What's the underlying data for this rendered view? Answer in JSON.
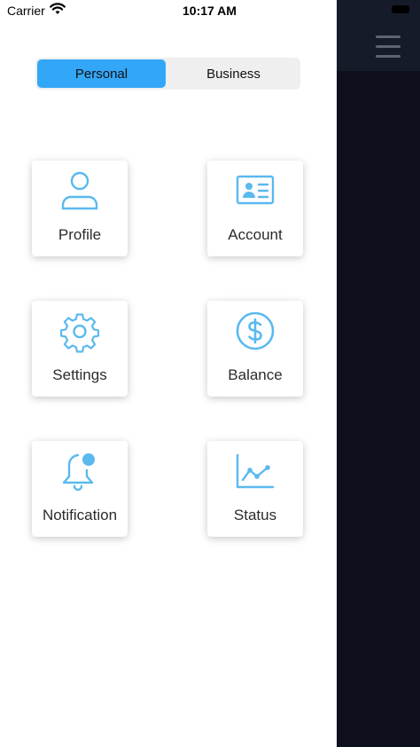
{
  "status_bar": {
    "carrier": "Carrier",
    "time": "10:17 AM"
  },
  "segmented": {
    "personal": "Personal",
    "business": "Business",
    "selected": "Personal"
  },
  "tiles": [
    {
      "label": "Profile",
      "icon": "person-icon"
    },
    {
      "label": "Account",
      "icon": "id-card-icon"
    },
    {
      "label": "Settings",
      "icon": "gear-icon"
    },
    {
      "label": "Balance",
      "icon": "dollar-icon"
    },
    {
      "label": "Notification",
      "icon": "bell-icon"
    },
    {
      "label": "Status",
      "icon": "chart-icon"
    }
  ],
  "colors": {
    "accent": "#33a7f7",
    "icon": "#5ab9ee",
    "sidebar_bg": "#0e111d",
    "sidebar_header": "#161b29"
  }
}
